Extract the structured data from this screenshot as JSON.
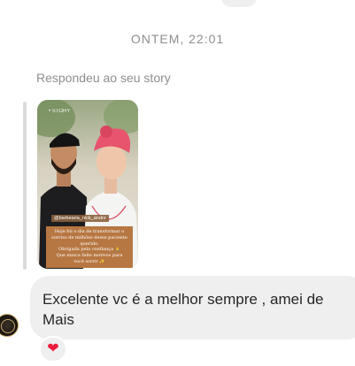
{
  "thread": {
    "timestamp": "ONTEM, 22:01",
    "reply_label": "Respondeu ao seu story",
    "story": {
      "tag_text": "• STORY",
      "handle": "@barbearia_nick_andre",
      "caption": "Hoje foi o dia de transformar o\nsorriso de milhões desse paciente\nquerido.\nObrigada pela confiança 🙏\nQue nunca falte motivos para\nvocê sorrir ✨"
    },
    "message": {
      "text": "Excelente vc é a melhor sempre , amei de Mais",
      "reaction": "❤"
    }
  },
  "colors": {
    "bubble": "#efefef",
    "meta_text": "#8e8e8e",
    "message_text": "#262626",
    "reaction_heart": "#ed1c3b",
    "caption_box": "#b77742",
    "pink_turban": "#e8546d"
  }
}
